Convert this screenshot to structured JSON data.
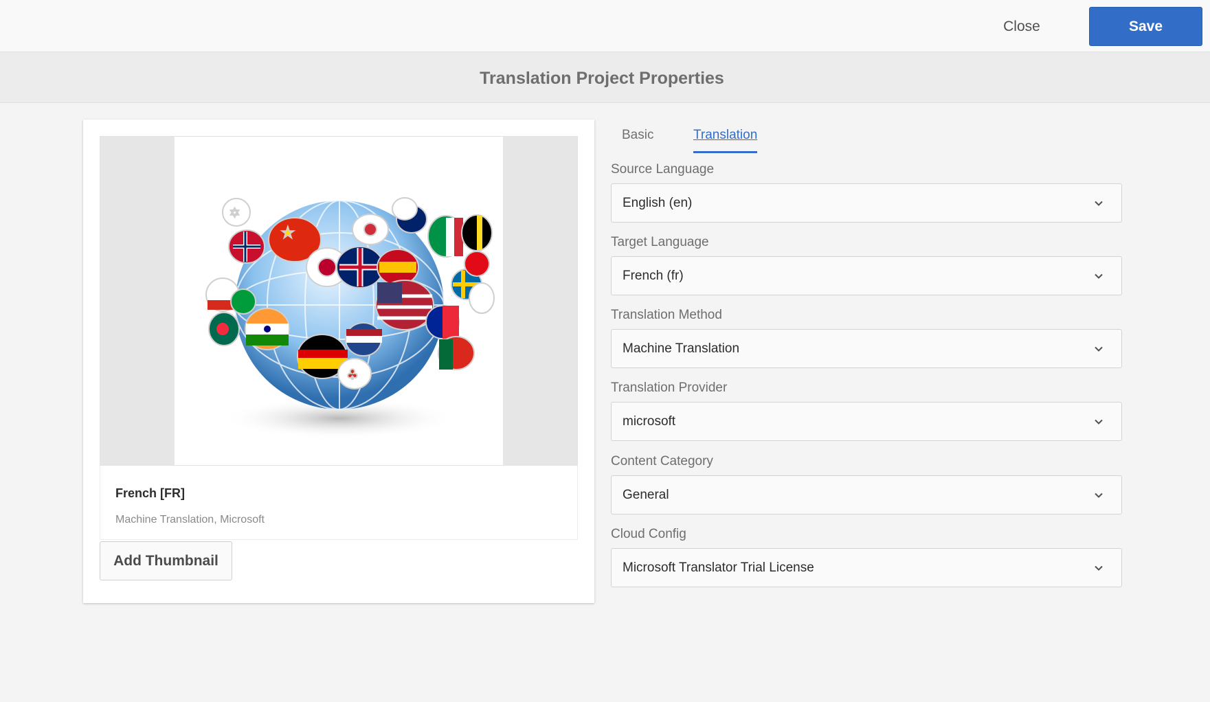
{
  "header": {
    "close_label": "Close",
    "save_label": "Save"
  },
  "page": {
    "title": "Translation Project Properties"
  },
  "card": {
    "image_alt": "globe with speech-bubble flags",
    "title": "French [FR]",
    "subtitle": "Machine Translation, Microsoft",
    "add_thumbnail_label": "Add Thumbnail"
  },
  "tabs": [
    {
      "label": "Basic",
      "active": false
    },
    {
      "label": "Translation",
      "active": true
    }
  ],
  "fields": [
    {
      "label": "Source Language",
      "value": "English (en)"
    },
    {
      "label": "Target Language",
      "value": "French (fr)"
    },
    {
      "label": "Translation Method",
      "value": "Machine Translation"
    },
    {
      "label": "Translation Provider",
      "value": "microsoft"
    },
    {
      "label": "Content Category",
      "value": "General"
    },
    {
      "label": "Cloud Config",
      "value": "Microsoft Translator Trial License"
    }
  ],
  "colors": {
    "accent": "#326ec8",
    "background": "#f4f4f4"
  },
  "icons": {
    "dropdown": "chevron-down-icon"
  }
}
